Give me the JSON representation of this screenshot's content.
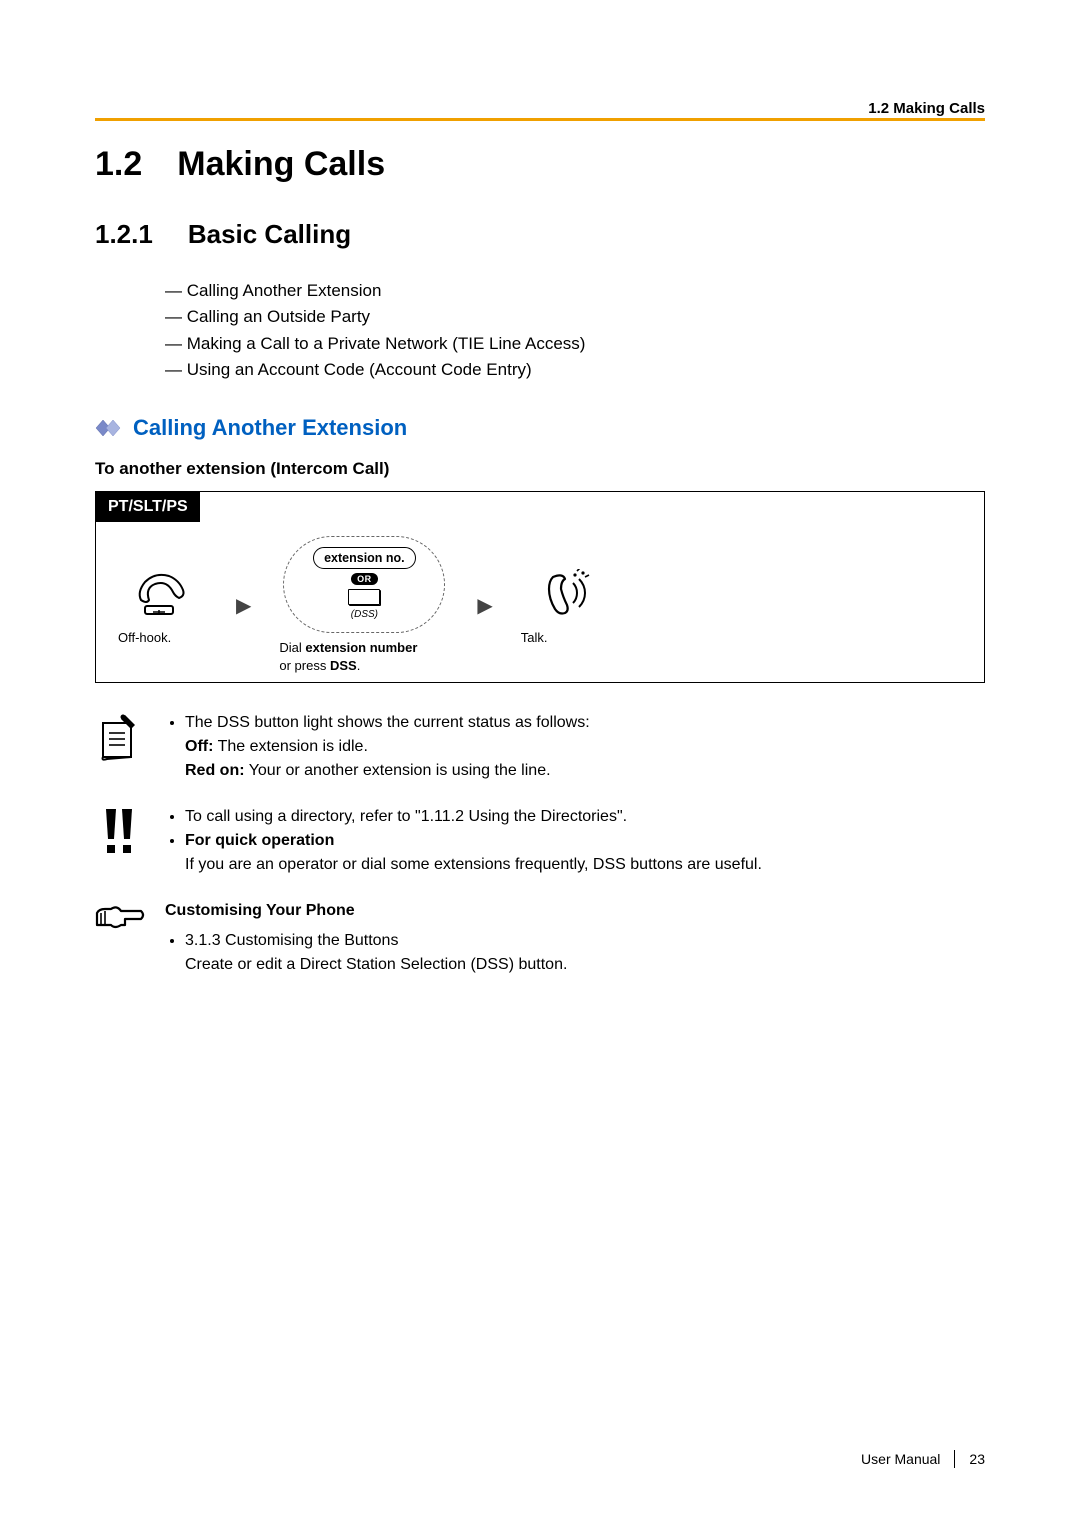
{
  "header": {
    "running": "1.2 Making Calls"
  },
  "h1": {
    "num": "1.2",
    "title": "Making Calls"
  },
  "h2": {
    "num": "1.2.1",
    "title": "Basic Calling"
  },
  "toc": [
    "Calling Another Extension",
    "Calling an Outside Party",
    "Making a Call to a Private Network (TIE Line Access)",
    "Using an Account Code (Account Code Entry)"
  ],
  "blue_heading": "Calling Another Extension",
  "black_sub": "To another extension (Intercom Call)",
  "proc": {
    "tab": "PT/SLT/PS",
    "step1_caption": "Off-hook.",
    "ext_label": "extension no.",
    "or": "OR",
    "dss": "(DSS)",
    "step2_caption_a": "Dial ",
    "step2_caption_b": "extension number",
    "step2_caption_c": "or press ",
    "step2_caption_d": "DSS",
    "step2_caption_e": ".",
    "step3_caption": "Talk."
  },
  "note1": {
    "line1": "The DSS button light shows the current status as follows:",
    "off_b": "Off:",
    "off_t": " The extension is idle.",
    "red_b": "Red on:",
    "red_t": " Your or another extension is using the line."
  },
  "note2": {
    "line1": "To call using a directory, refer to \"1.11.2 Using the Directories\".",
    "quick_b": "For quick operation",
    "quick_t": "If you are an operator or dial some extensions frequently, DSS buttons are useful."
  },
  "note3": {
    "title": "Customising Your Phone",
    "item": "3.1.3 Customising the Buttons",
    "desc": "Create or edit a Direct Station Selection (DSS) button."
  },
  "footer": {
    "label": "User Manual",
    "page": "23"
  }
}
